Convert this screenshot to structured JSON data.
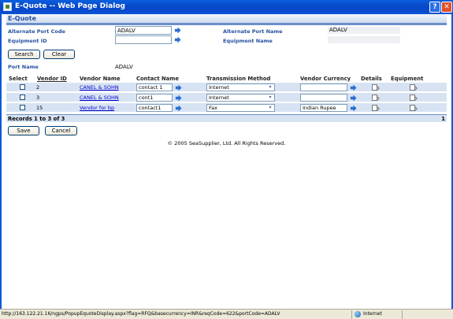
{
  "window": {
    "title": "E-Quote -- Web Page Dialog",
    "help": "?",
    "close": "✕"
  },
  "header": {
    "title": "E-Quote"
  },
  "form": {
    "alt_port_code_label": "Alternate Port Code",
    "alt_port_code_value": "ADALV",
    "alt_port_name_label": "Alternate Port Name",
    "alt_port_name_value": "ADALV",
    "equipment_id_label": "Equipment ID",
    "equipment_id_value": "",
    "equipment_name_label": "Equipment Name",
    "equipment_name_value": "",
    "search_button": "Search",
    "clear_button": "Clear",
    "port_name_label": "Port Name",
    "port_name_value": "ADALV"
  },
  "table": {
    "columns": [
      "Select",
      "Vendor ID",
      "Vendor Name",
      "Contact Name",
      "Transmission Method",
      "Vendor Currency",
      "Details",
      "Equipment"
    ],
    "rows": [
      {
        "vendor_id": "2",
        "vendor_name": "CANEL & SOHN",
        "contact": "contact 1",
        "method": "Internet",
        "currency": ""
      },
      {
        "vendor_id": "3",
        "vendor_name": "CANEL & SOHN",
        "contact": "cont1",
        "method": "Internet",
        "currency": ""
      },
      {
        "vendor_id": "15",
        "vendor_name": "Vendor for bp",
        "contact": "contact1",
        "method": "Fax",
        "currency": "Indian Rupee"
      }
    ],
    "records": "Records 1 to 3 of 3",
    "page": "1"
  },
  "actions": {
    "save": "Save",
    "cancel": "Cancel"
  },
  "footer": {
    "copyright": "© 2005 SeaSupplier, Ltd. All Rights Reserved."
  },
  "statusbar": {
    "url": "http://163.122.21.16/ngps/PopupEquoteDisplay.aspx?flag=RFQ&basecurrency=INR&reqCode=622&portCode=ADALV",
    "zone": "Internet"
  },
  "colors": {
    "accent": "#2850a0",
    "row_bg": "#d7e3f3",
    "titlebar": "#0a4bd0",
    "arrow": "#2a6fd0"
  },
  "icons": {
    "go": "arrow-right-icon",
    "dropdown": "chevron-down-icon",
    "details": "document-icon",
    "globe": "globe-icon"
  }
}
